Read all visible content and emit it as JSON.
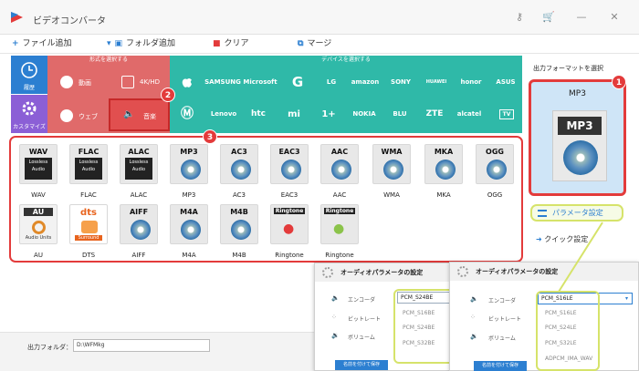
{
  "window": {
    "title": "ビデオコンバータ"
  },
  "toolbar": {
    "add_file": "ファイル追加",
    "add_folder": "フォルダ追加",
    "clear": "クリア",
    "merge": "マージ"
  },
  "sidebar": {
    "history": "履歴",
    "customize": "カスタマイズ"
  },
  "sections": {
    "format": "形式を選択する",
    "device": "デバイスを選択する"
  },
  "format_tabs": [
    "動画",
    "4K/HD",
    "ウェブ",
    "音楽"
  ],
  "devices_row1": [
    "SAMSUNG",
    "Microsoft",
    "G",
    "LG",
    "amazon",
    "SONY",
    "HUAWEI",
    "honor",
    "ASUS"
  ],
  "devices_row2": [
    "Motorola",
    "Lenovo",
    "htc",
    "mi",
    "1+",
    "NOKIA",
    "BLU",
    "ZTE",
    "alcatel",
    "TV"
  ],
  "formats": [
    {
      "name": "WAV",
      "label": "WAV",
      "sub": "Lossless Audio"
    },
    {
      "name": "FLAC",
      "label": "FLAC",
      "sub": "Lossless Audio"
    },
    {
      "name": "ALAC",
      "label": "ALAC",
      "sub": "Lossless Audio"
    },
    {
      "name": "MP3",
      "label": "MP3",
      "sub": ""
    },
    {
      "name": "AC3",
      "label": "AC3",
      "sub": ""
    },
    {
      "name": "EAC3",
      "label": "EAC3",
      "sub": ""
    },
    {
      "name": "AAC",
      "label": "AAC",
      "sub": ""
    },
    {
      "name": "WMA",
      "label": "WMA",
      "sub": ""
    },
    {
      "name": "MKA",
      "label": "MKA",
      "sub": ""
    },
    {
      "name": "OGG",
      "label": "OGG",
      "sub": ""
    },
    {
      "name": "AU",
      "label": "AU",
      "sub": "Audio Units"
    },
    {
      "name": "DTS",
      "label": "dts",
      "sub": "Surround"
    },
    {
      "name": "AIFF",
      "label": "AIFF",
      "sub": ""
    },
    {
      "name": "M4A",
      "label": "M4A",
      "sub": ""
    },
    {
      "name": "M4B",
      "label": "M4B",
      "sub": ""
    },
    {
      "name": "Ringtone",
      "label": "Ringtone",
      "sub": ""
    },
    {
      "name": "Ringtone",
      "label": "Ringtone",
      "sub": ""
    }
  ],
  "right_panel": {
    "title": "出力フォーマットを選択",
    "selected": "MP3",
    "selected_icon": "MP3",
    "param_button": "パラメータ設定",
    "quick_settings": "クイック設定"
  },
  "badges": [
    "1",
    "2",
    "3"
  ],
  "bottom": {
    "output_folder_label": "出力フォルダ：",
    "output_folder_value": "D:\\WFMkg"
  },
  "dialog_back": {
    "title": "オーディオパラメータの設定",
    "encoder": "エンコーダ",
    "bitrate": "ビットレート",
    "volume": "ボリューム",
    "selected": "PCM_S24BE",
    "options": [
      "PCM_S16BE",
      "PCM_S24BE",
      "PCM_S32BE"
    ],
    "save": "名前を付けて保存"
  },
  "dialog_front": {
    "title": "オーディオパラメータの設定",
    "encoder": "エンコーダ",
    "bitrate": "ビットレート",
    "volume": "ボリューム",
    "selected": "PCM_S16LE",
    "options": [
      "PCM_S16LE",
      "PCM_S24LE",
      "PCM_S32LE",
      "ADPCM_IMA_WAV"
    ],
    "save": "名前を付けて保存"
  },
  "colors": {
    "accent_red": "#e33b3b",
    "teal": "#2fb9a8",
    "blue": "#2c7fd1",
    "pink": "#e06a6a",
    "highlight": "#d6e36a"
  }
}
